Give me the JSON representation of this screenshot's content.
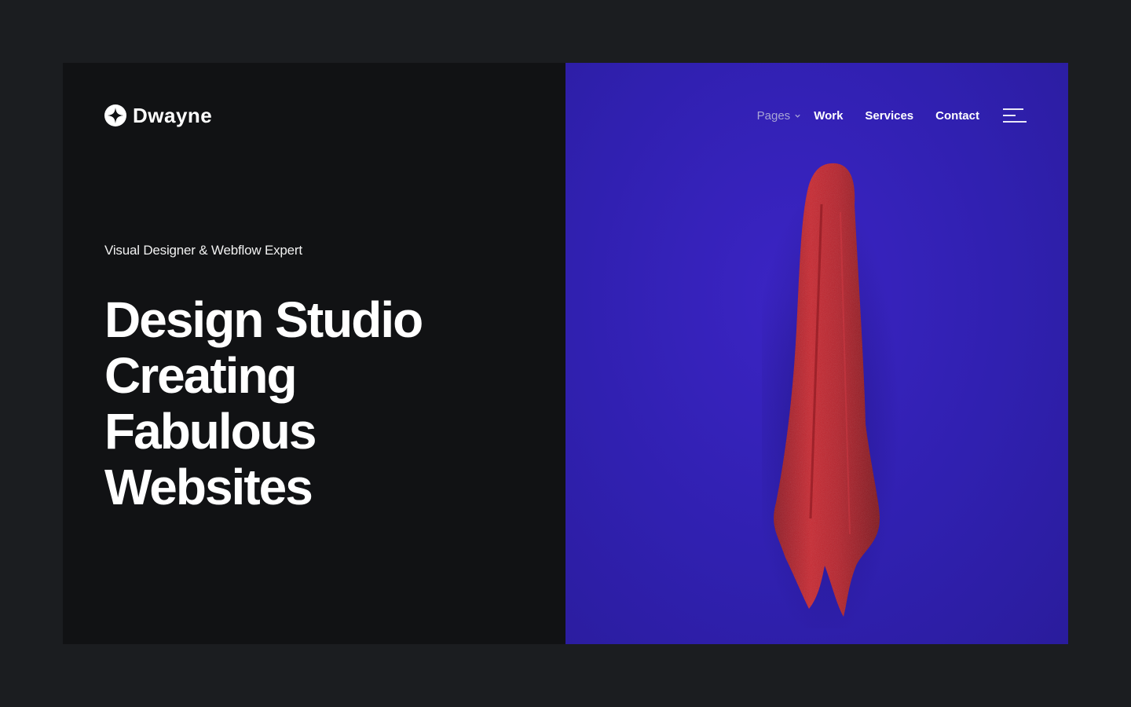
{
  "brand": {
    "name": "Dwayne",
    "logo_icon": "four-point-star-icon"
  },
  "hero": {
    "subtitle": "Visual Designer & Webflow Expert",
    "headline": [
      "Design Studio",
      "Creating",
      "Fabulous",
      "Websites"
    ]
  },
  "nav": {
    "pages_label": "Pages",
    "items": [
      {
        "label": "Work"
      },
      {
        "label": "Services"
      },
      {
        "label": "Contact"
      }
    ],
    "menu_icon": "hamburger-menu-icon"
  },
  "colors": {
    "left_bg": "#111214",
    "right_bg": "#3020b0",
    "towel": "#c0202a",
    "page_bg": "#1b1d20"
  }
}
